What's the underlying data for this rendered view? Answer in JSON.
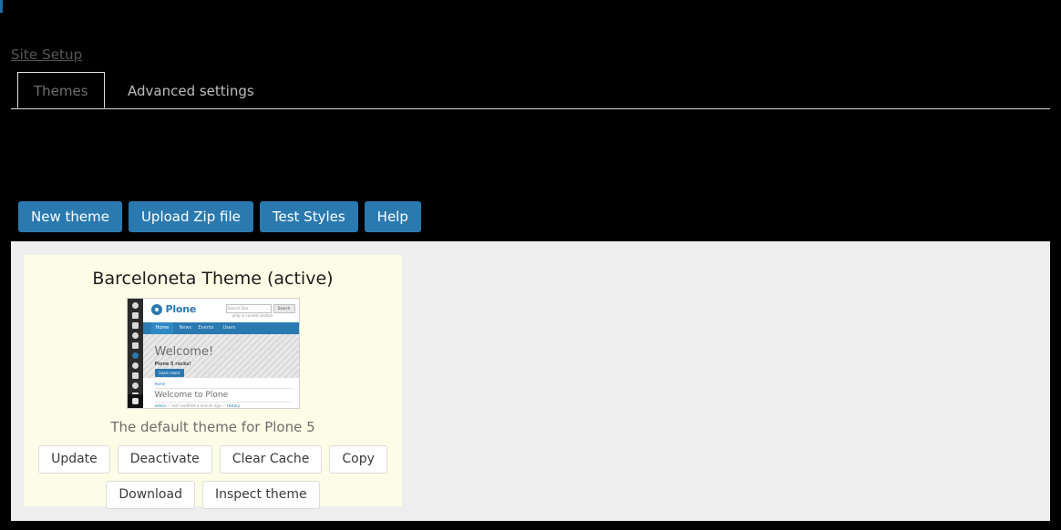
{
  "breadcrumb": {
    "label": "Site Setup"
  },
  "tabs": [
    {
      "label": "Themes",
      "active": true
    },
    {
      "label": "Advanced settings",
      "active": false
    }
  ],
  "toolbar": {
    "buttons": [
      "New theme",
      "Upload Zip file",
      "Test Styles",
      "Help"
    ],
    "accent_color": "#2a7ab0"
  },
  "theme_card": {
    "title": "Barceloneta Theme (active)",
    "description": "The default theme for Plone 5",
    "background_color": "#fdfde7",
    "actions_row1": [
      "Update",
      "Deactivate",
      "Clear Cache",
      "Copy"
    ],
    "actions_row2": [
      "Download",
      "Inspect theme"
    ],
    "preview": {
      "logo_text": "Plone",
      "search_placeholder": "Search Site",
      "search_button": "Search",
      "search_checkbox_label": "only in current section",
      "nav_items": [
        "Home",
        "News",
        "Events",
        "Users"
      ],
      "hero_title": "Welcome!",
      "hero_subtitle": "Plone 5 rocks!",
      "hero_button": "Learn more",
      "breadcrumb": "Home",
      "page_title": "Welcome to Plone",
      "byline_author": "admin",
      "byline_rest": " — last modified a minute ago — ",
      "byline_link": "History"
    }
  },
  "panel": {
    "background_color": "#eeeeee"
  }
}
